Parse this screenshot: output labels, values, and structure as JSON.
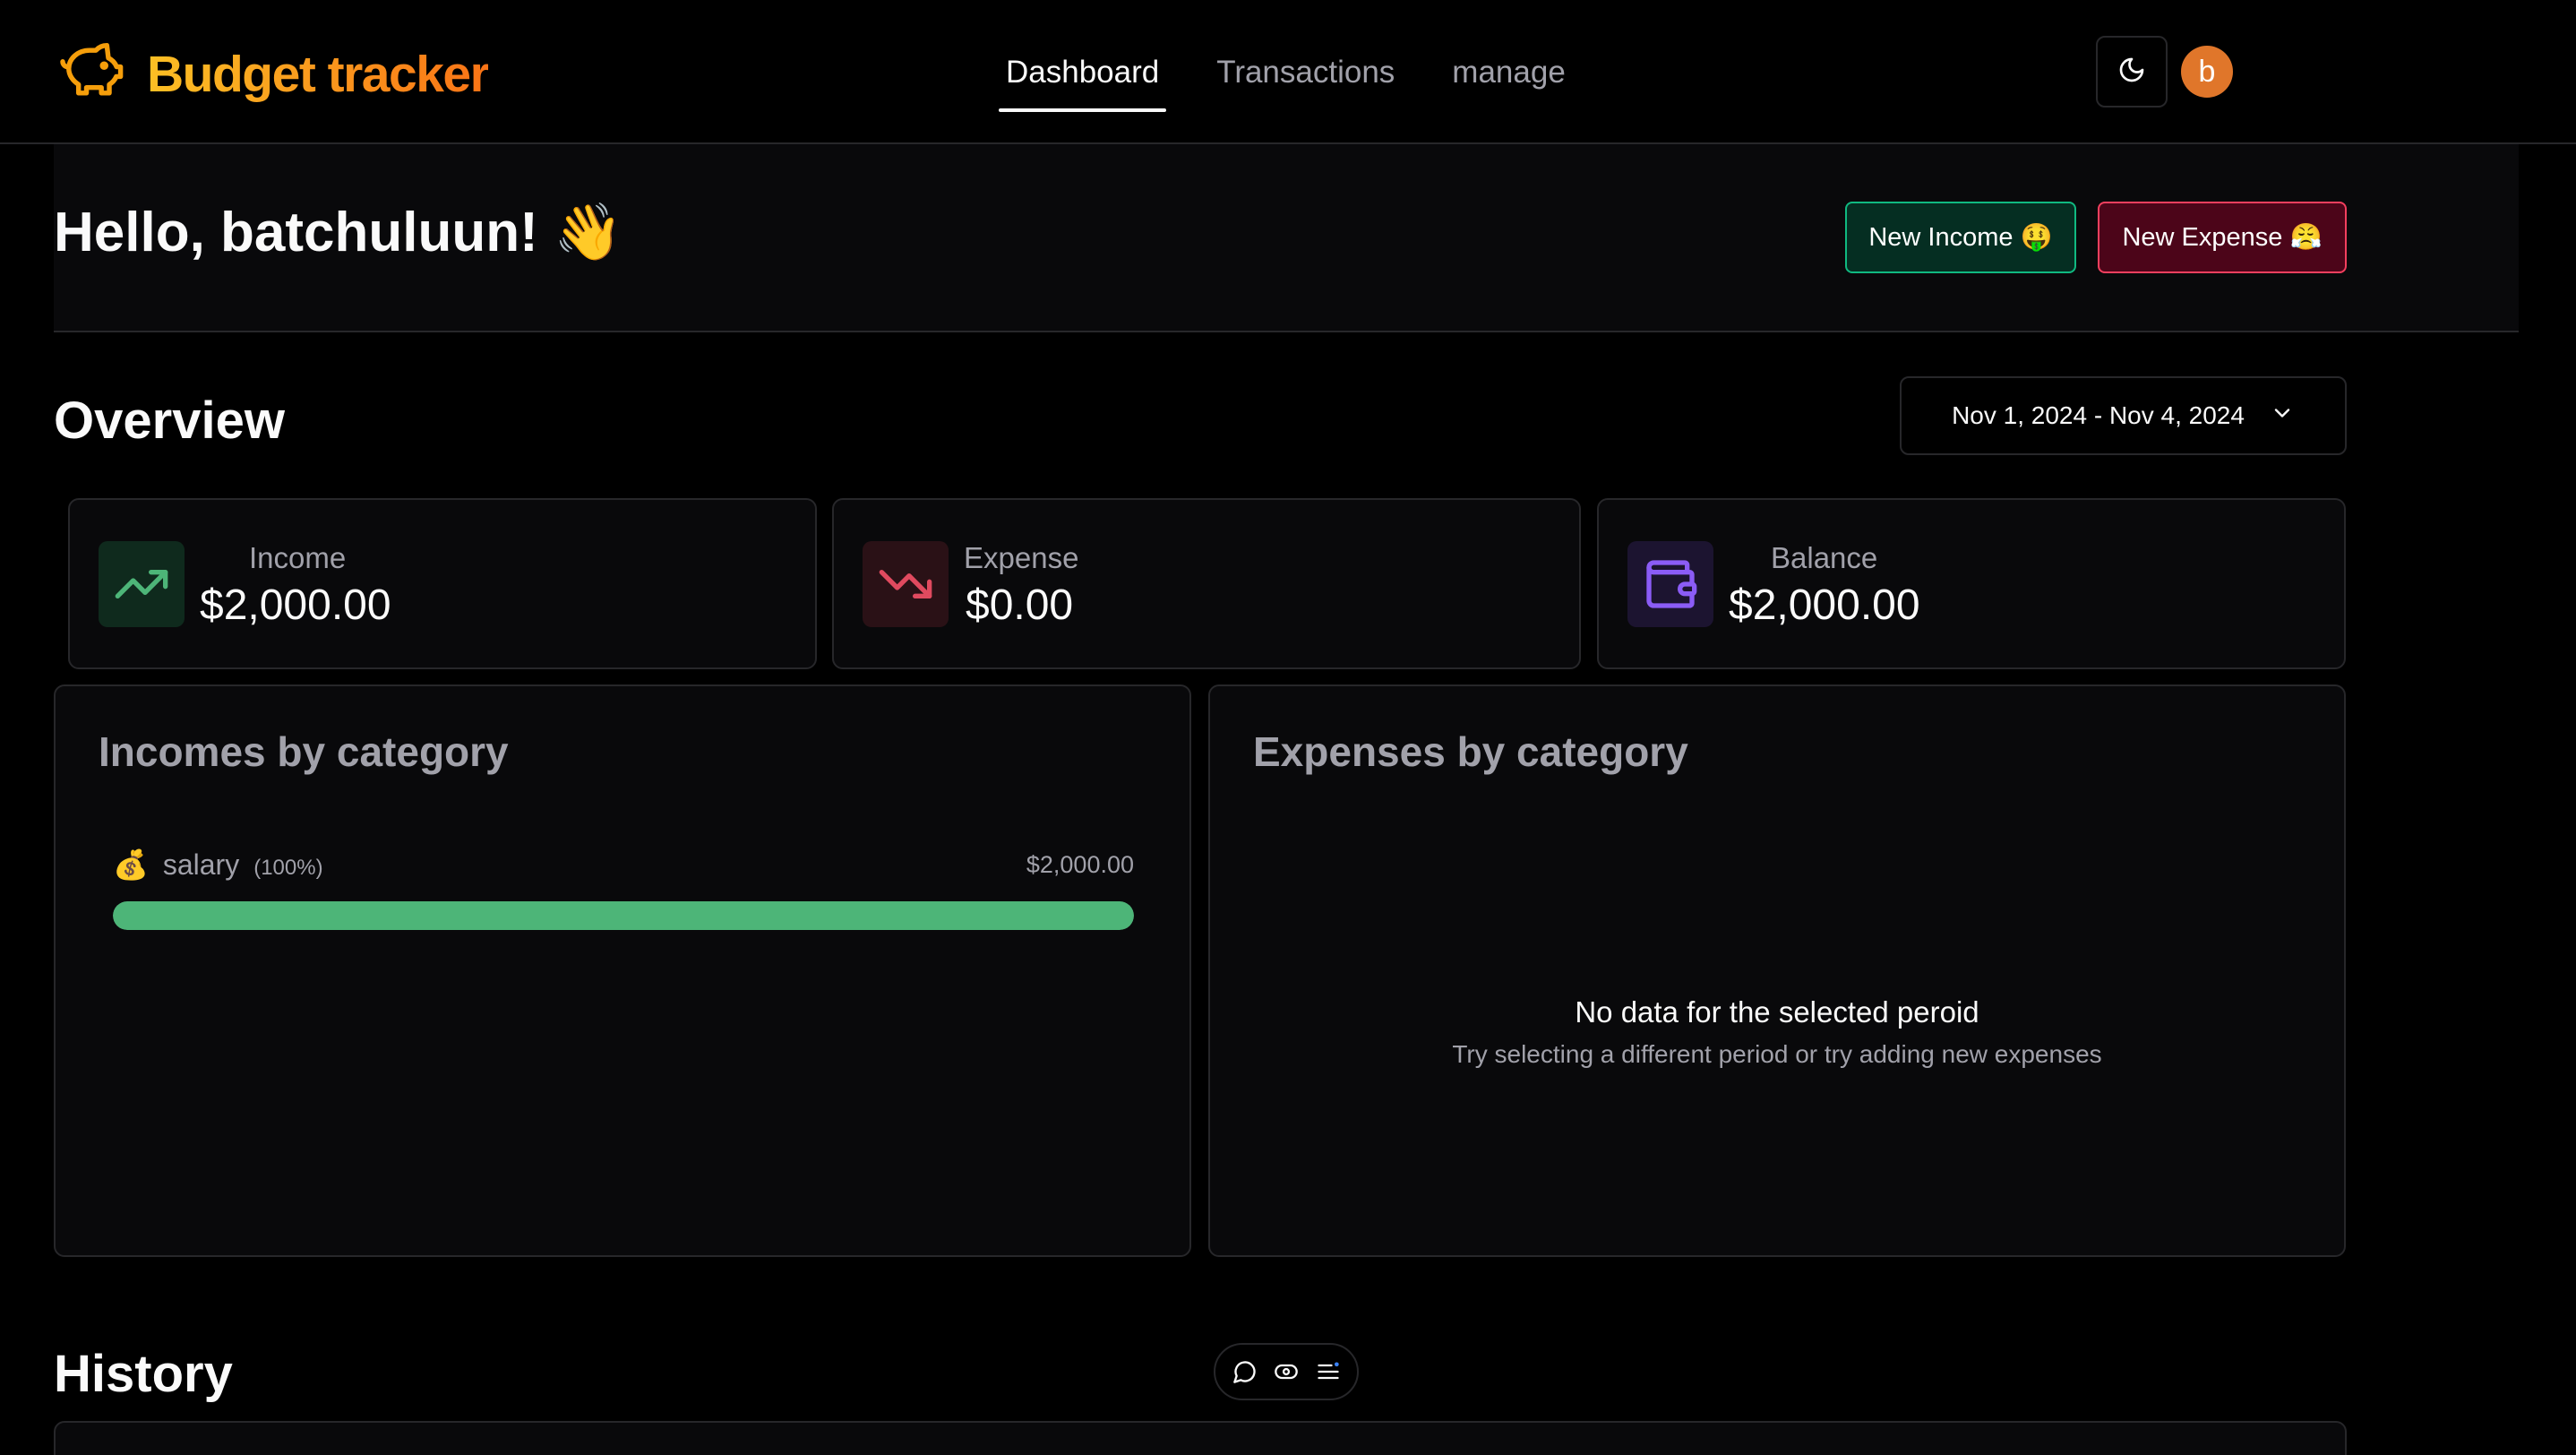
{
  "app": {
    "name": "Budget tracker"
  },
  "nav": {
    "items": [
      {
        "label": "Dashboard",
        "active": true
      },
      {
        "label": "Transactions",
        "active": false
      },
      {
        "label": "manage",
        "active": false
      }
    ]
  },
  "user": {
    "avatar_initial": "b"
  },
  "greeting": {
    "text": "Hello, batchuluun! 👋"
  },
  "actions": {
    "new_income": "New Income 🤑",
    "new_expense": "New Expense 😤"
  },
  "overview": {
    "title": "Overview",
    "date_range": "Nov 1, 2024 - Nov 4, 2024",
    "stats": [
      {
        "label": "Income",
        "value": "$2,000.00",
        "color": "#4db578"
      },
      {
        "label": "Expense",
        "value": "$0.00",
        "color": "#e04a5f"
      },
      {
        "label": "Balance",
        "value": "$2,000.00",
        "color": "#8b5cf6"
      }
    ]
  },
  "incomes_by_category": {
    "title": "Incomes by category",
    "items": [
      {
        "icon": "💰",
        "name": "salary",
        "percent_label": "(100%)",
        "amount": "$2,000.00",
        "percent": 100
      }
    ]
  },
  "expenses_by_category": {
    "title": "Expenses by category",
    "empty_title": "No data for the selected peroid",
    "empty_subtitle": "Try selecting a different period or try adding new expenses"
  },
  "history": {
    "title": "History"
  },
  "colors": {
    "accent_from": "#fbbf24",
    "accent_to": "#f97316",
    "income_green": "#4db578",
    "expense_red": "#e04a5f",
    "balance_purple": "#8b5cf6"
  }
}
